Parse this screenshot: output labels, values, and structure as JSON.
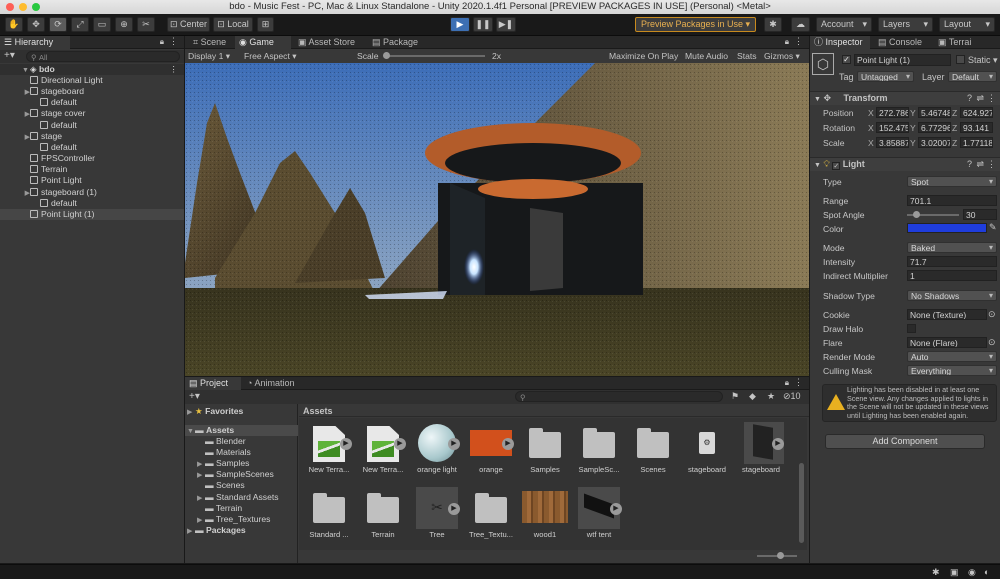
{
  "window": {
    "title": "bdo - Music Fest - PC, Mac & Linux Standalone - Unity 2020.1.4f1 Personal [PREVIEW PACKAGES IN USE] (Personal) <Metal>"
  },
  "toolbar": {
    "center_label": "Center",
    "local_label": "Local",
    "preview_packages_label": "Preview Packages in Use",
    "account_label": "Account",
    "layers_label": "Layers",
    "layout_label": "Layout"
  },
  "hierarchy": {
    "tab_label": "Hierarchy",
    "search_placeholder": "All",
    "scene_name": "bdo",
    "items": [
      {
        "label": "Directional Light",
        "indent": 1
      },
      {
        "label": "stageboard",
        "indent": 1
      },
      {
        "label": "default",
        "indent": 2
      },
      {
        "label": "stage cover",
        "indent": 1
      },
      {
        "label": "default",
        "indent": 2
      },
      {
        "label": "stage",
        "indent": 1
      },
      {
        "label": "default",
        "indent": 2
      },
      {
        "label": "FPSController",
        "indent": 1
      },
      {
        "label": "Terrain",
        "indent": 1
      },
      {
        "label": "Point Light",
        "indent": 1
      },
      {
        "label": "stageboard (1)",
        "indent": 1
      },
      {
        "label": "default",
        "indent": 2
      },
      {
        "label": "Point Light (1)",
        "indent": 1
      }
    ]
  },
  "game_view": {
    "tabs": [
      "Scene",
      "Game",
      "Asset Store",
      "Package Manager"
    ],
    "display": "Display 1",
    "aspect": "Free Aspect",
    "scale_label": "Scale",
    "scale_value": "2x",
    "maximize_label": "Maximize On Play",
    "mute_label": "Mute Audio",
    "stats_label": "Stats",
    "gizmos_label": "Gizmos"
  },
  "project": {
    "tabs": [
      "Project",
      "Animation"
    ],
    "hidden_count": "10",
    "favorites_label": "Favorites",
    "assets_label": "Assets",
    "packages_label": "Packages",
    "tree": [
      "Blender",
      "Materials",
      "Samples",
      "SampleScenes",
      "Scenes",
      "Standard Assets",
      "Terrain",
      "Tree_Textures"
    ],
    "breadcrumb": "Assets",
    "assets": [
      {
        "label": "New Terra...",
        "kind": "terrain"
      },
      {
        "label": "New Terra...",
        "kind": "terrain"
      },
      {
        "label": "orange light",
        "kind": "sphere"
      },
      {
        "label": "orange",
        "kind": "orange"
      },
      {
        "label": "Samples",
        "kind": "folder"
      },
      {
        "label": "SampleSc...",
        "kind": "folder"
      },
      {
        "label": "Scenes",
        "kind": "folder"
      },
      {
        "label": "stageboard",
        "kind": "file"
      },
      {
        "label": "stageboard",
        "kind": "mesh"
      },
      {
        "label": "Standard ...",
        "kind": "folder"
      },
      {
        "label": "Terrain",
        "kind": "folder"
      },
      {
        "label": "Tree",
        "kind": "tree"
      },
      {
        "label": "Tree_Textu...",
        "kind": "folder"
      },
      {
        "label": "wood1",
        "kind": "wood"
      },
      {
        "label": "wtf tent",
        "kind": "tent"
      }
    ]
  },
  "inspector": {
    "tabs": [
      "Inspector",
      "Console",
      "Terrai"
    ],
    "object_name": "Point Light (1)",
    "static_label": "Static",
    "tag_label": "Tag",
    "tag_value": "Untagged",
    "layer_label": "Layer",
    "layer_value": "Default",
    "transform": {
      "title": "Transform",
      "position_label": "Position",
      "rotation_label": "Rotation",
      "scale_label": "Scale",
      "position": [
        "272.786",
        "5.46748",
        "624.927"
      ],
      "rotation": [
        "152.475",
        "6.77296",
        "93.141"
      ],
      "scale": [
        "3.85887",
        "3.02007",
        "1.77118"
      ]
    },
    "light": {
      "title": "Light",
      "type_label": "Type",
      "type_value": "Spot",
      "range_label": "Range",
      "range_value": "701.1",
      "spot_angle_label": "Spot Angle",
      "spot_angle_value": "30",
      "color_label": "Color",
      "color_hex": "#1f3ddc",
      "mode_label": "Mode",
      "mode_value": "Baked",
      "intensity_label": "Intensity",
      "intensity_value": "71.7",
      "indirect_label": "Indirect Multiplier",
      "indirect_value": "1",
      "shadow_label": "Shadow Type",
      "shadow_value": "No Shadows",
      "cookie_label": "Cookie",
      "cookie_value": "None (Texture)",
      "halo_label": "Draw Halo",
      "flare_label": "Flare",
      "flare_value": "None (Flare)",
      "render_label": "Render Mode",
      "render_value": "Auto",
      "culling_label": "Culling Mask",
      "culling_value": "Everything",
      "warning": "Lighting has been disabled in at least one Scene view. Any changes applied to lights in the Scene will not be updated in these views until Lighting has been enabled again."
    },
    "add_component_label": "Add Component"
  },
  "colors": {
    "accent": "#3d6fb3",
    "warning_bg": "#2e2e2e",
    "preview_border": "#c88a1e"
  }
}
